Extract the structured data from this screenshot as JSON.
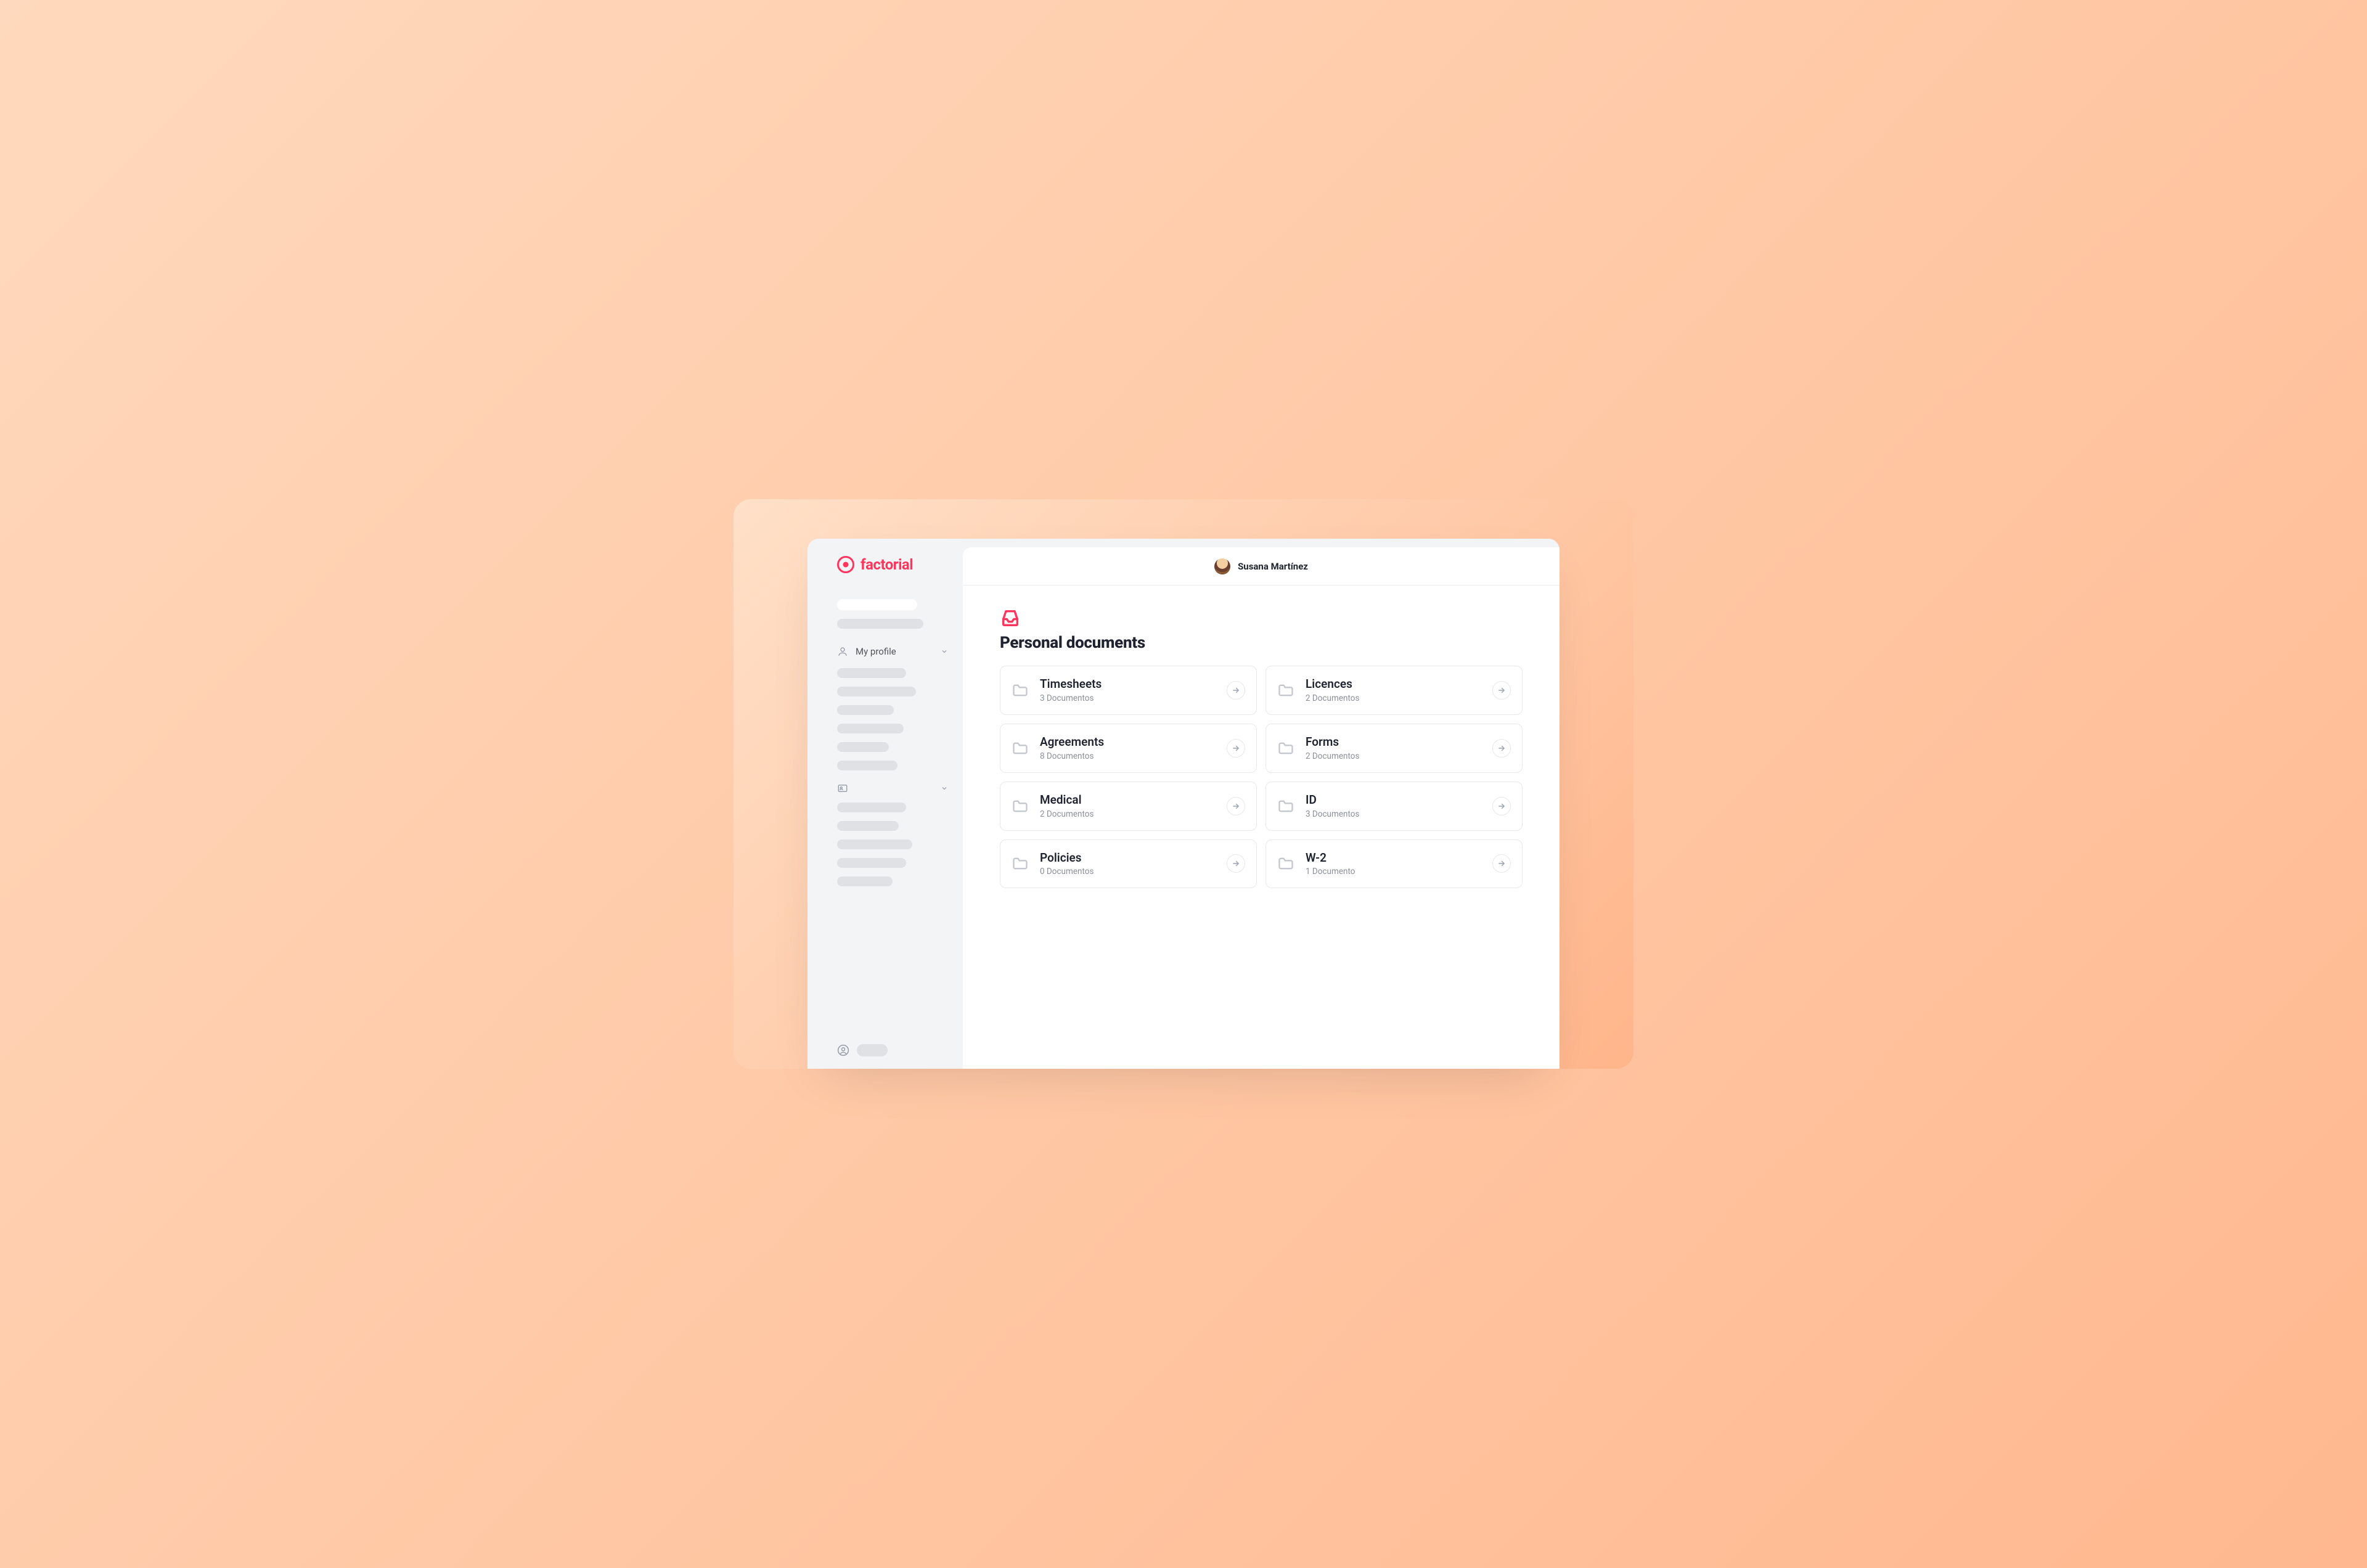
{
  "brand": {
    "name": "factorial",
    "accent": "#ff355e"
  },
  "sidebar": {
    "my_profile_label": "My profile"
  },
  "topbar": {
    "user_name": "Susana Martínez"
  },
  "section": {
    "title": "Personal documents"
  },
  "folders": [
    {
      "title": "Timesheets",
      "sub": "3 Documentos"
    },
    {
      "title": "Licences",
      "sub": "2 Documentos"
    },
    {
      "title": "Agreements",
      "sub": "8 Documentos"
    },
    {
      "title": "Forms",
      "sub": "2 Documentos"
    },
    {
      "title": "Medical",
      "sub": "2 Documentos"
    },
    {
      "title": "ID",
      "sub": "3 Documentos"
    },
    {
      "title": "Policies",
      "sub": "0 Documentos"
    },
    {
      "title": "W-2",
      "sub": "1 Documento"
    }
  ]
}
